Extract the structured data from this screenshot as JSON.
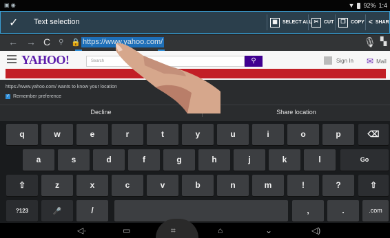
{
  "status_bar": {
    "left_icons": "▣ ◉",
    "battery": "92%",
    "time": "1:4"
  },
  "action_bar": {
    "title": "Text selection",
    "actions": [
      {
        "label": "SELECT ALL",
        "icon": "select-all-icon"
      },
      {
        "label": "CUT",
        "icon": "cut-icon"
      },
      {
        "label": "COPY",
        "icon": "copy-icon"
      },
      {
        "label": "SHAR",
        "icon": "share-icon"
      }
    ]
  },
  "url_bar": {
    "url": "https://www.yahoo.com/"
  },
  "page": {
    "logo": "YAHOO!",
    "search_placeholder": "Search",
    "sign_in": "Sign In",
    "mail": "Mail"
  },
  "location_prompt": {
    "message": "https://www.yahoo.com/ wants to know your location",
    "remember_label": "Remember preference",
    "decline": "Decline",
    "share": "Share location"
  },
  "keyboard": {
    "row1": [
      "q",
      "w",
      "e",
      "r",
      "t",
      "y",
      "u",
      "i",
      "o",
      "p",
      "⌫"
    ],
    "row2": [
      "a",
      "s",
      "d",
      "f",
      "g",
      "h",
      "j",
      "k",
      "l",
      "Go"
    ],
    "row3": [
      "⇧",
      "z",
      "x",
      "c",
      "v",
      "b",
      "n",
      "m",
      "!",
      "?",
      "⇧"
    ],
    "row4": [
      "?123",
      "🎤",
      "/",
      "",
      ",",
      ".",
      ".com"
    ]
  },
  "colors": {
    "accent": "#2f8ed8",
    "action_bar": "#2b3f4c",
    "yahoo_purple": "#400090",
    "yahoo_red": "#c21f26"
  }
}
